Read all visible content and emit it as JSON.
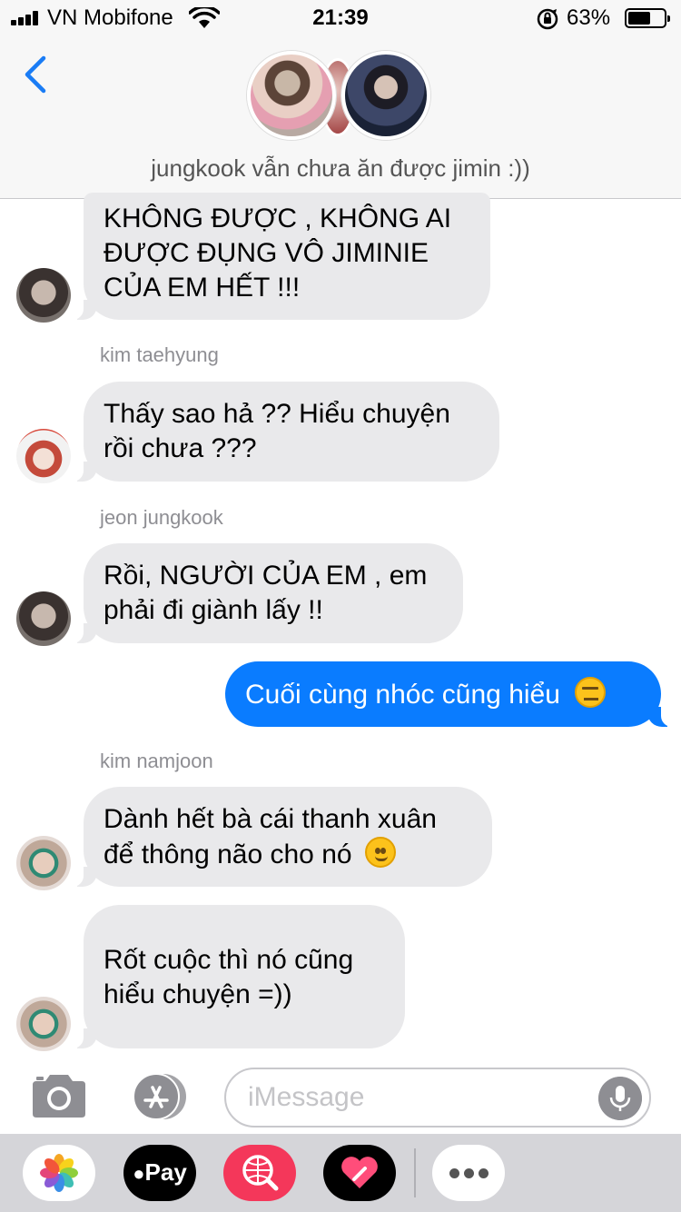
{
  "status_bar": {
    "carrier": "VN Mobifone",
    "time": "21:39",
    "battery_percent": "63%",
    "battery_level": 0.63
  },
  "header": {
    "back_icon": "chevron-left-icon",
    "group_name": "jungkook vẫn chưa ăn được jimin :))"
  },
  "messages": [
    {
      "sender": "",
      "direction": "incoming",
      "lines": [
        "KHÔNG ĐƯỢC , KHÔNG AI",
        "ĐƯỢC ĐỤNG VÔ JIMINIE",
        "CỦA EM HẾT !!!"
      ]
    },
    {
      "sender": "kim taehyung",
      "direction": "incoming",
      "lines": [
        "Thấy sao hả ?? Hiểu chuyện",
        "rồi chưa ???"
      ]
    },
    {
      "sender": "jeon jungkook",
      "direction": "incoming",
      "lines": [
        "Rồi, NGƯỜI CỦA EM , em",
        "phải đi giành lấy !!"
      ]
    },
    {
      "sender": "",
      "direction": "outgoing",
      "lines": [
        "Cuối cùng nhóc cũng hiểu"
      ],
      "emoji": "expressionless-face"
    },
    {
      "sender": "kim namjoon",
      "direction": "incoming",
      "lines": [
        "Dành hết bà cái thanh xuân",
        "để thông não cho nó"
      ],
      "emoji": "slightly-smiling-face"
    },
    {
      "sender": "",
      "direction": "incoming",
      "lines": [
        "Rốt cuộc thì nó cũng",
        "hiểu chuyện =))"
      ]
    }
  ],
  "compose": {
    "placeholder": "iMessage",
    "value": ""
  },
  "app_drawer": {
    "pay_label": "Pay",
    "apps": [
      "photos-app-icon",
      "apple-pay-icon",
      "search-images-icon",
      "digital-touch-icon",
      "more-icon"
    ]
  },
  "colors": {
    "outgoing_bubble": "#0a7cff",
    "incoming_bubble": "#e9e9eb",
    "back_chevron": "#1a7cf5"
  }
}
